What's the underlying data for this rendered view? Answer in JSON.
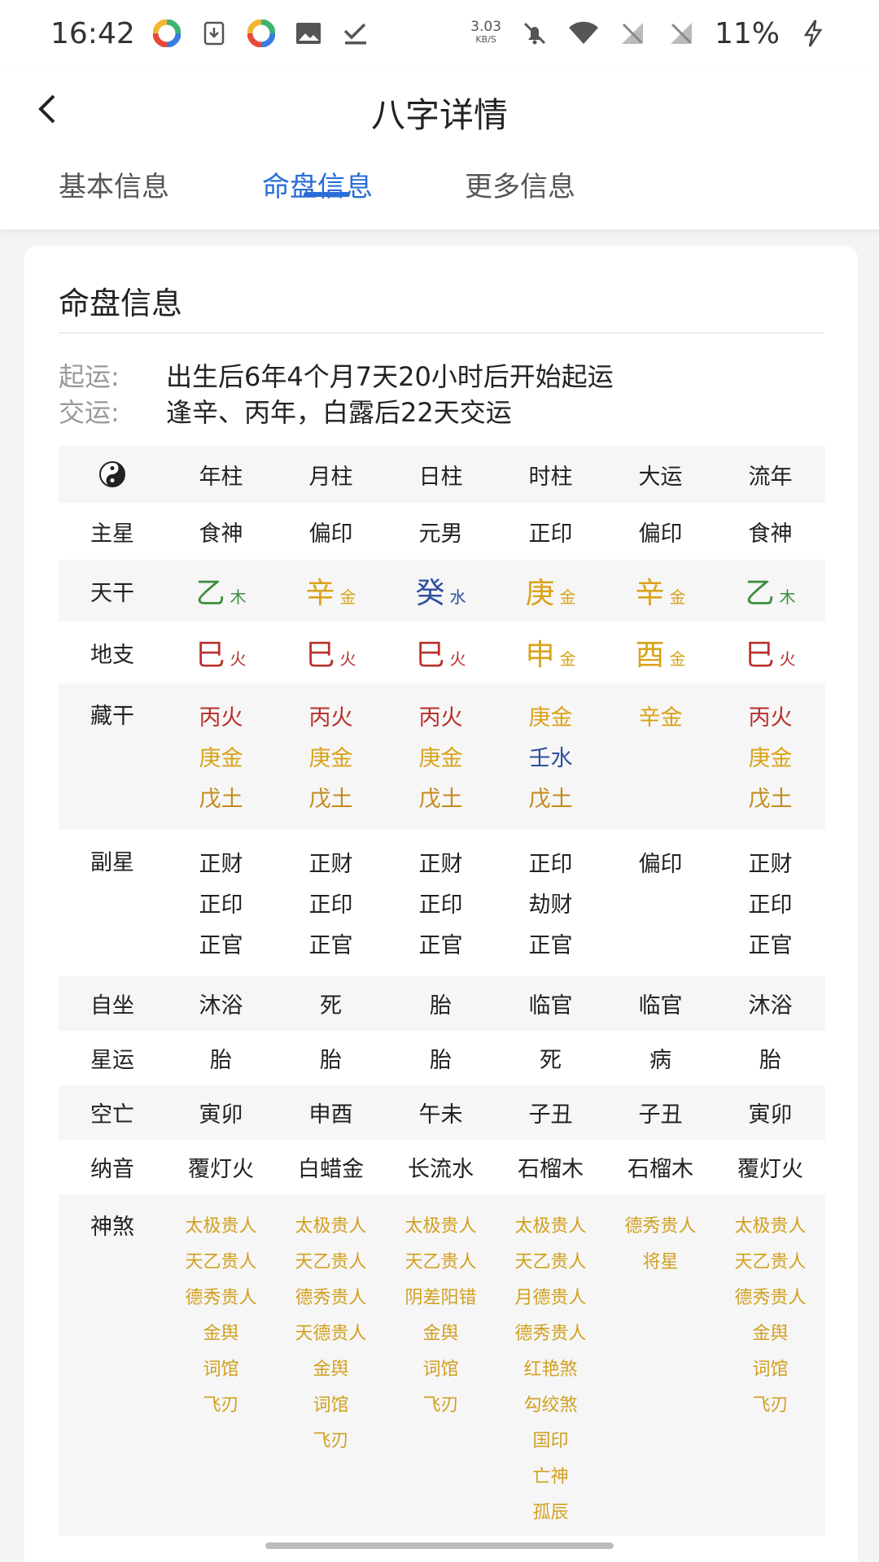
{
  "status": {
    "time": "16:42",
    "net_speed_value": "3.03",
    "net_speed_unit": "KB/S",
    "battery": "11%"
  },
  "header": {
    "title": "八字详情",
    "tabs": [
      "基本信息",
      "命盘信息",
      "更多信息"
    ],
    "active_tab": "命盘信息"
  },
  "card": {
    "title": "命盘信息",
    "qiyun_label": "起运:",
    "qiyun_value": "出生后6年4个月7天20小时后开始起运",
    "jiaoyun_label": "交运:",
    "jiaoyun_value": "逢辛、丙年，白露后22天交运"
  },
  "table": {
    "columns": [
      "年柱",
      "月柱",
      "日柱",
      "时柱",
      "大运",
      "流年"
    ],
    "rows": {
      "zhuxing": {
        "label": "主星",
        "values": [
          "食神",
          "偏印",
          "元男",
          "正印",
          "偏印",
          "食神"
        ]
      },
      "tiangan": {
        "label": "天干",
        "values": [
          {
            "char": "乙",
            "el": "木",
            "color": "#3e8e3e"
          },
          {
            "char": "辛",
            "el": "金",
            "color": "#d9a318"
          },
          {
            "char": "癸",
            "el": "水",
            "color": "#2c4f9e"
          },
          {
            "char": "庚",
            "el": "金",
            "color": "#d9a318"
          },
          {
            "char": "辛",
            "el": "金",
            "color": "#d9a318"
          },
          {
            "char": "乙",
            "el": "木",
            "color": "#3e8e3e"
          }
        ]
      },
      "dizhi": {
        "label": "地支",
        "values": [
          {
            "char": "巳",
            "el": "火",
            "color": "#b8302b"
          },
          {
            "char": "巳",
            "el": "火",
            "color": "#b8302b"
          },
          {
            "char": "巳",
            "el": "火",
            "color": "#b8302b"
          },
          {
            "char": "申",
            "el": "金",
            "color": "#d9a318"
          },
          {
            "char": "酉",
            "el": "金",
            "color": "#d9a318"
          },
          {
            "char": "巳",
            "el": "火",
            "color": "#b8302b"
          }
        ]
      },
      "canggan": {
        "label": "藏干",
        "values": [
          [
            "丙火",
            "庚金",
            "戊土"
          ],
          [
            "丙火",
            "庚金",
            "戊土"
          ],
          [
            "丙火",
            "庚金",
            "戊土"
          ],
          [
            "庚金",
            "壬水",
            "戊土"
          ],
          [
            "辛金"
          ],
          [
            "丙火",
            "庚金",
            "戊土"
          ]
        ]
      },
      "fuxing": {
        "label": "副星",
        "values": [
          [
            "正财",
            "正印",
            "正官"
          ],
          [
            "正财",
            "正印",
            "正官"
          ],
          [
            "正财",
            "正印",
            "正官"
          ],
          [
            "正印",
            "劫财",
            "正官"
          ],
          [
            "偏印"
          ],
          [
            "正财",
            "正印",
            "正官"
          ]
        ]
      },
      "zizuo": {
        "label": "自坐",
        "values": [
          "沐浴",
          "死",
          "胎",
          "临官",
          "临官",
          "沐浴"
        ]
      },
      "xingyun": {
        "label": "星运",
        "values": [
          "胎",
          "胎",
          "胎",
          "死",
          "病",
          "胎"
        ]
      },
      "kongwang": {
        "label": "空亡",
        "values": [
          "寅卯",
          "申酉",
          "午未",
          "子丑",
          "子丑",
          "寅卯"
        ]
      },
      "nayin": {
        "label": "纳音",
        "values": [
          "覆灯火",
          "白蜡金",
          "长流水",
          "石榴木",
          "石榴木",
          "覆灯火"
        ]
      },
      "shensha": {
        "label": "神煞",
        "values": [
          [
            "太极贵人",
            "天乙贵人",
            "德秀贵人",
            "金舆",
            "词馆",
            "飞刃"
          ],
          [
            "太极贵人",
            "天乙贵人",
            "德秀贵人",
            "天德贵人",
            "金舆",
            "词馆",
            "飞刃"
          ],
          [
            "太极贵人",
            "天乙贵人",
            "阴差阳错",
            "金舆",
            "词馆",
            "飞刃"
          ],
          [
            "太极贵人",
            "天乙贵人",
            "月德贵人",
            "德秀贵人",
            "红艳煞",
            "勾绞煞",
            "国印",
            "亡神",
            "孤辰"
          ],
          [
            "德秀贵人",
            "将星"
          ],
          [
            "太极贵人",
            "天乙贵人",
            "德秀贵人",
            "金舆",
            "词馆",
            "飞刃"
          ]
        ]
      }
    }
  },
  "colors": {
    "accent": "#2a6dd6",
    "wood": "#3e8e3e",
    "metal": "#d9a318",
    "water": "#2c4f9e",
    "fire": "#b8302b",
    "shensha": "#d2a020"
  }
}
